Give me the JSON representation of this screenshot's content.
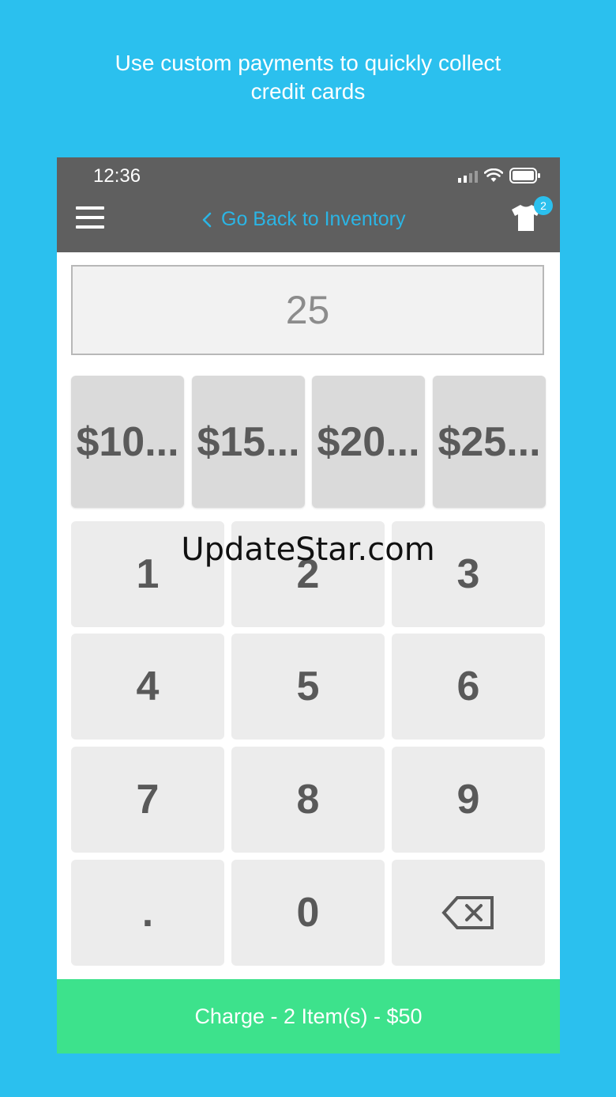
{
  "promo": {
    "line1": "Use custom payments to quickly collect",
    "line2": "credit cards"
  },
  "status_bar": {
    "time": "12:36"
  },
  "nav": {
    "back_label": "Go Back to Inventory",
    "cart_count": "2"
  },
  "amount": {
    "value": "25"
  },
  "quick_amounts": [
    "$10...",
    "$15...",
    "$20...",
    "$25..."
  ],
  "keypad": {
    "k1": "1",
    "k2": "2",
    "k3": "3",
    "k4": "4",
    "k5": "5",
    "k6": "6",
    "k7": "7",
    "k8": "8",
    "k9": "9",
    "dot": ".",
    "k0": "0"
  },
  "watermark": "UpdateStar.com",
  "charge_button": "Charge - 2 Item(s) - $50",
  "colors": {
    "background": "#2bc0ee",
    "topbar": "#5f5f5f",
    "accent": "#2bb5e5",
    "charge": "#3de28c"
  }
}
